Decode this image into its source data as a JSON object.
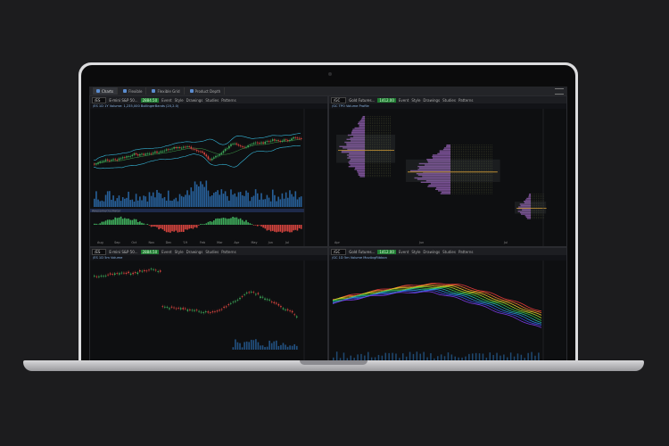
{
  "tabs": [
    {
      "label": "Charts",
      "active": true
    },
    {
      "label": "Flexible",
      "active": false
    },
    {
      "label": "Flexible Grid",
      "active": false
    },
    {
      "label": "Product Depth",
      "active": false
    }
  ],
  "panes": {
    "top_left": {
      "symbol": "/ES",
      "description": "E-mini S&P 50...",
      "price": "2884.50",
      "buttons": [
        "Event",
        "Style",
        "Drawings",
        "Studies",
        "Patterns"
      ],
      "infobar": "/ES 1D 1Y   Volume: 1,235,000   BollingerBands (20,2.0)",
      "study_label": "AwesomeOscillator",
      "x_labels": [
        "Aug",
        "Sep",
        "Oct",
        "Nov",
        "Dec",
        "'19",
        "Feb",
        "Mar",
        "Apr",
        "May",
        "Jun",
        "Jul"
      ]
    },
    "top_right": {
      "symbol": "/GC",
      "description": "Gold Futures...",
      "price": "1412.00",
      "buttons": [
        "Event",
        "Style",
        "Drawings",
        "Studies",
        "Patterns"
      ],
      "infobar": "/GC TPO   Volume Profile",
      "x_labels": [
        "Apr",
        "Jun",
        "Jul"
      ]
    },
    "bottom_left": {
      "symbol": "/ES",
      "description": "E-mini S&P 50...",
      "price": "2884.50",
      "buttons": [
        "Event",
        "Style",
        "Drawings",
        "Studies",
        "Patterns"
      ],
      "infobar": "/ES 1D 5m   Volume"
    },
    "bottom_right": {
      "symbol": "/GC",
      "description": "Gold Futures...",
      "price": "1412.00",
      "buttons": [
        "Event",
        "Style",
        "Drawings",
        "Studies",
        "Patterns"
      ],
      "infobar": "/GC 1D 5m   Volume   MovAvgRibbon"
    }
  },
  "colors": {
    "up": "#3fae5c",
    "down": "#d9453f",
    "bollinger": "#35b6d8",
    "volume": "#2b6fb3",
    "profile": "#8a5aa8",
    "poc": "#e3a32c"
  }
}
